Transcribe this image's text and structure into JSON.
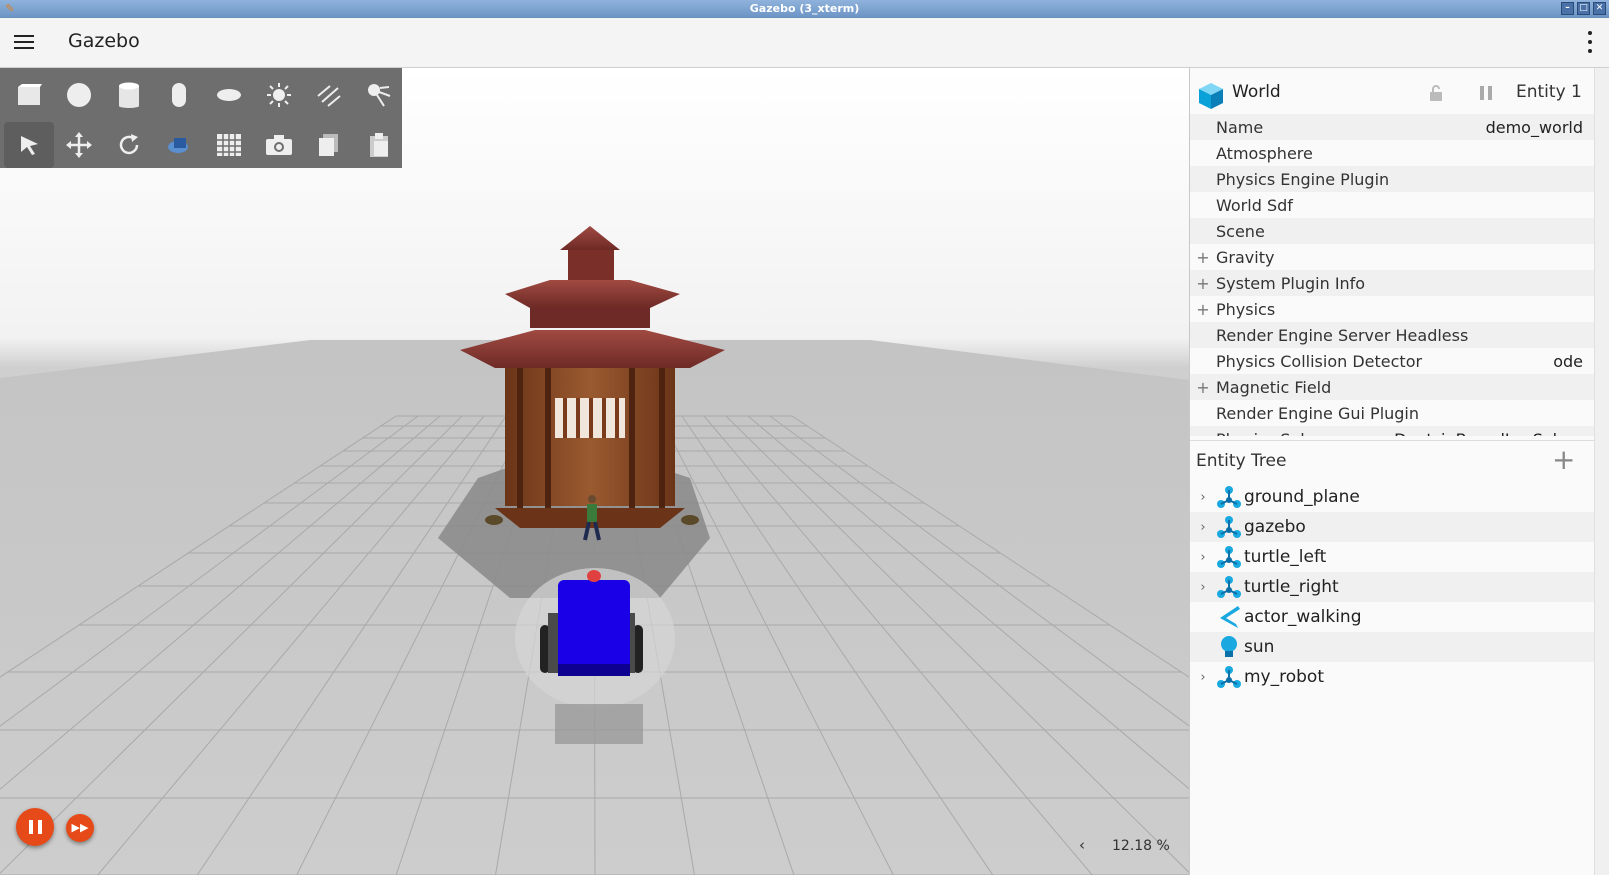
{
  "window": {
    "title": "Gazebo (3_xterm)"
  },
  "appbar": {
    "title": "Gazebo"
  },
  "toolbar": {
    "row1": [
      "box-icon",
      "sphere-icon",
      "cylinder-icon",
      "capsule-icon",
      "ellipsoid-icon",
      "point-light-icon",
      "directional-light-icon",
      "spot-light-icon"
    ],
    "row2": [
      "select-icon",
      "translate-icon",
      "rotate-icon",
      "transform-icon",
      "grid-config-icon",
      "screenshot-icon",
      "copy-icon",
      "paste-icon"
    ]
  },
  "playback": {
    "rtf": "12.18 %"
  },
  "component_inspector": {
    "entity_name": "World",
    "entity_id": "Entity 1",
    "rows": [
      {
        "label": "Name",
        "value": "demo_world",
        "expandable": false
      },
      {
        "label": "Atmosphere",
        "value": "",
        "expandable": false
      },
      {
        "label": "Physics Engine Plugin",
        "value": "",
        "expandable": false
      },
      {
        "label": "World Sdf",
        "value": "",
        "expandable": false
      },
      {
        "label": "Scene",
        "value": "",
        "expandable": false
      },
      {
        "label": "Gravity",
        "value": "",
        "expandable": true
      },
      {
        "label": "System Plugin Info",
        "value": "",
        "expandable": true
      },
      {
        "label": "Physics",
        "value": "",
        "expandable": true
      },
      {
        "label": "Render Engine Server Headless",
        "value": "",
        "expandable": false
      },
      {
        "label": "Physics Collision Detector",
        "value": "ode",
        "expandable": false
      },
      {
        "label": "Magnetic Field",
        "value": "",
        "expandable": true
      },
      {
        "label": "Render Engine Gui Plugin",
        "value": "",
        "expandable": false
      },
      {
        "label": "Physics Solver",
        "value": "DantzigBoxedLcpSolver",
        "expandable": false
      }
    ]
  },
  "entity_tree": {
    "title": "Entity Tree",
    "items": [
      {
        "name": "ground_plane",
        "icon": "model-icon",
        "expandable": true
      },
      {
        "name": "gazebo",
        "icon": "model-icon",
        "expandable": true
      },
      {
        "name": "turtle_left",
        "icon": "model-icon",
        "expandable": true
      },
      {
        "name": "turtle_right",
        "icon": "model-icon",
        "expandable": true
      },
      {
        "name": "actor_walking",
        "icon": "actor-icon",
        "expandable": false
      },
      {
        "name": "sun",
        "icon": "light-icon",
        "expandable": false
      },
      {
        "name": "my_robot",
        "icon": "model-icon",
        "expandable": true
      }
    ]
  },
  "colors": {
    "accent": "#e64a19",
    "robot": "#1a00e6",
    "gazebo_roof": "#8a3a34"
  }
}
